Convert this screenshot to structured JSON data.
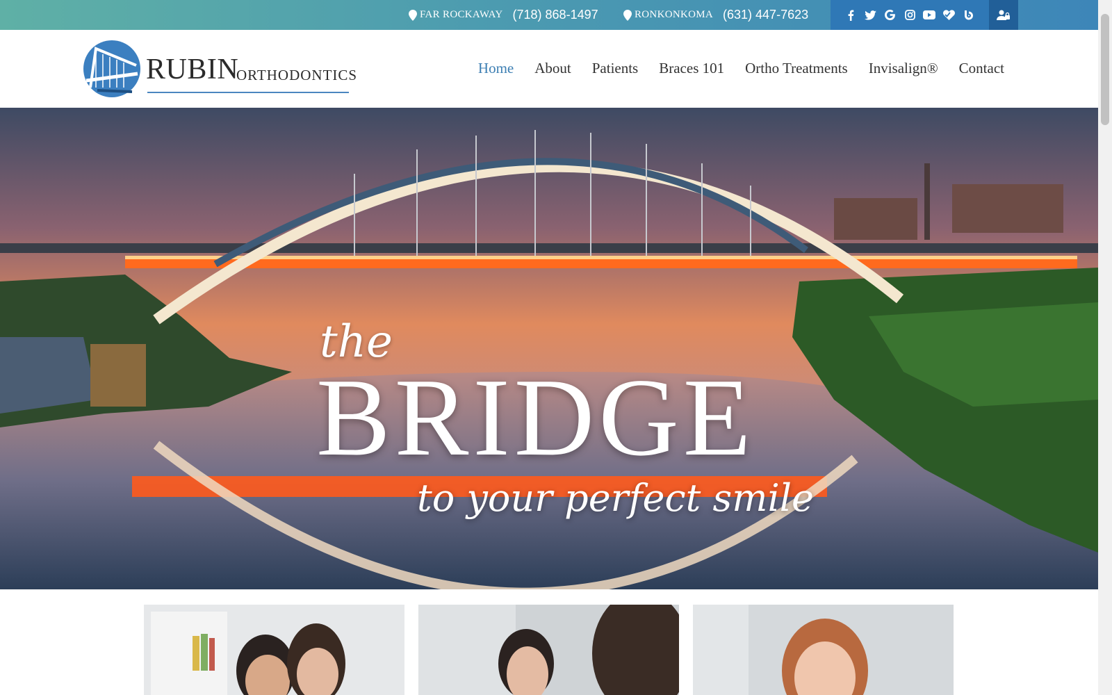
{
  "topbar": {
    "locations": [
      {
        "city": "FAR ROCKAWAY",
        "phone": "(718) 868-1497"
      },
      {
        "city": "RONKONKOMA",
        "phone": "(631) 447-7623"
      }
    ],
    "social_icons": [
      "facebook-icon",
      "twitter-icon",
      "google-icon",
      "instagram-icon",
      "youtube-icon",
      "healthgrades-icon",
      "blog-icon"
    ],
    "login_icon": "patient-login-icon"
  },
  "logo": {
    "word_main": "RUBIN",
    "word_sub": "ORTHODONTICS"
  },
  "nav": {
    "items": [
      {
        "label": "Home",
        "active": true
      },
      {
        "label": "About",
        "active": false
      },
      {
        "label": "Patients",
        "active": false
      },
      {
        "label": "Braces 101",
        "active": false
      },
      {
        "label": "Ortho Treatments",
        "active": false
      },
      {
        "label": "Invisalign®",
        "active": false
      },
      {
        "label": "Contact",
        "active": false
      }
    ]
  },
  "hero": {
    "line1": "the",
    "line2": "BRIDGE",
    "line3": "to your perfect smile"
  },
  "colors": {
    "topbar_start": "#5fb0a6",
    "topbar_end": "#3d86b8",
    "social_bg": "#2f78b6",
    "login_bg": "#215f98",
    "nav_active": "#3d7fb3"
  }
}
